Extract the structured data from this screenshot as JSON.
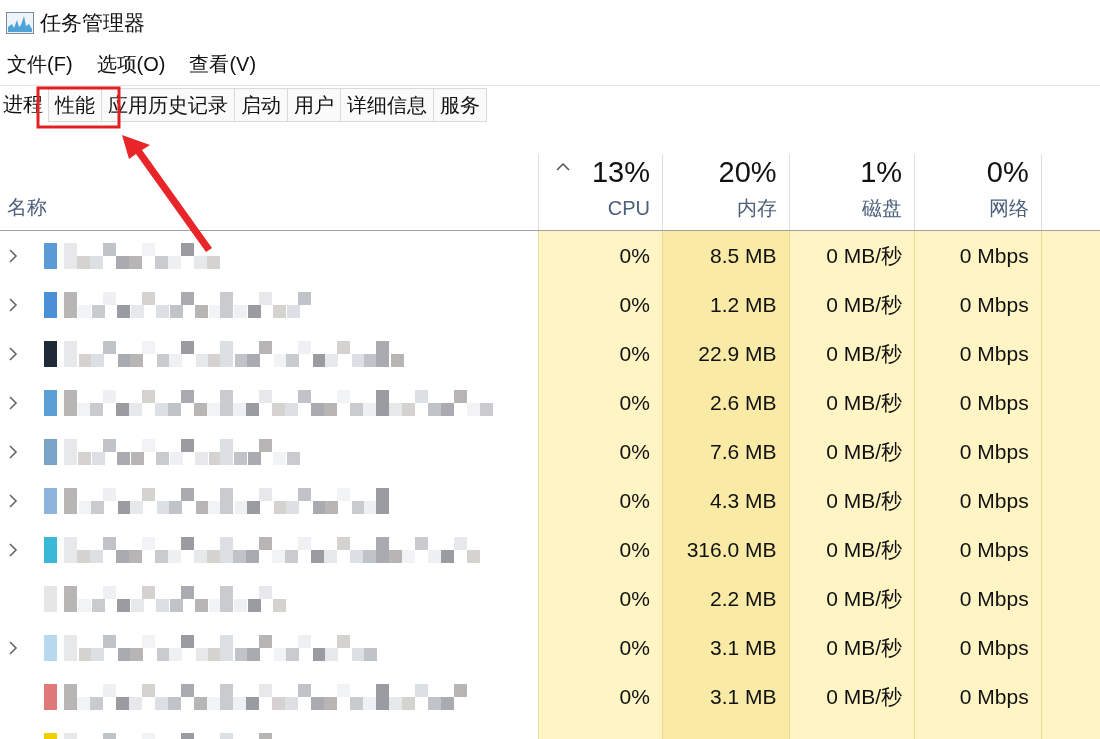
{
  "window": {
    "title": "任务管理器"
  },
  "menu": [
    "文件(F)",
    "选项(O)",
    "查看(V)"
  ],
  "tabs": [
    {
      "label": "进程",
      "selected": true
    },
    {
      "label": "性能",
      "selected": false
    },
    {
      "label": "应用历史记录",
      "selected": false
    },
    {
      "label": "启动",
      "selected": false
    },
    {
      "label": "用户",
      "selected": false
    },
    {
      "label": "详细信息",
      "selected": false
    },
    {
      "label": "服务",
      "selected": false
    }
  ],
  "table": {
    "name_column": "名称",
    "columns": [
      {
        "percent": "13%",
        "label": "CPU",
        "sorted": true
      },
      {
        "percent": "20%",
        "label": "内存",
        "sorted": false
      },
      {
        "percent": "1%",
        "label": "磁盘",
        "sorted": false
      },
      {
        "percent": "0%",
        "label": "网络",
        "sorted": false
      }
    ],
    "rows": [
      {
        "expandable": true,
        "values": [
          "0%",
          "8.5 MB",
          "0 MB/秒",
          "0 Mbps"
        ]
      },
      {
        "expandable": true,
        "values": [
          "0%",
          "1.2 MB",
          "0 MB/秒",
          "0 Mbps"
        ]
      },
      {
        "expandable": true,
        "values": [
          "0%",
          "22.9 MB",
          "0 MB/秒",
          "0 Mbps"
        ]
      },
      {
        "expandable": true,
        "values": [
          "0%",
          "2.6 MB",
          "0 MB/秒",
          "0 Mbps"
        ]
      },
      {
        "expandable": true,
        "values": [
          "0%",
          "7.6 MB",
          "0 MB/秒",
          "0 Mbps"
        ]
      },
      {
        "expandable": true,
        "values": [
          "0%",
          "4.3 MB",
          "0 MB/秒",
          "0 Mbps"
        ]
      },
      {
        "expandable": true,
        "values": [
          "0%",
          "316.0 MB",
          "0 MB/秒",
          "0 Mbps"
        ]
      },
      {
        "expandable": false,
        "values": [
          "0%",
          "2.2 MB",
          "0 MB/秒",
          "0 Mbps"
        ]
      },
      {
        "expandable": true,
        "values": [
          "0%",
          "3.1 MB",
          "0 MB/秒",
          "0 Mbps"
        ]
      },
      {
        "expandable": false,
        "values": [
          "0%",
          "3.1 MB",
          "0 MB/秒",
          "0 Mbps"
        ]
      },
      {
        "expandable": false
      }
    ]
  }
}
